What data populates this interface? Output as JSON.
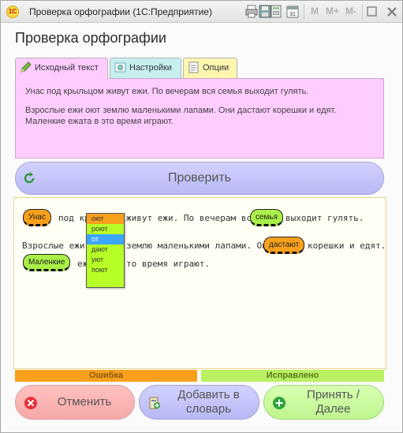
{
  "window": {
    "logo": "1С",
    "title": "Проверка орфографии  (1С:Предприятие)",
    "toolbar": {
      "m": "M",
      "m_plus": "M+",
      "m_minus": "M-"
    }
  },
  "page_title": "Проверка орфографии",
  "tabs": [
    {
      "label": "Исходный текст",
      "icon": "pencil-icon",
      "color": "#ffccff"
    },
    {
      "label": "Настройки",
      "icon": "settings-icon",
      "color": "#c6f0f0"
    },
    {
      "label": "Опции",
      "icon": "options-icon",
      "color": "#fff6b0"
    }
  ],
  "source_text": {
    "p1": "Унас под крыльцом живут ежи. По вечерам вся семья выходит гулять.",
    "p2": "Взрослые ежи оют землю маленькими лапами. Они дастают корешки и едят.",
    "p3": "Маленкие ежата в это время играют."
  },
  "check_button": "Проверить",
  "result": {
    "line1_a": "под кр",
    "line1_b": "живут ежи. По вечерам вся",
    "line1_c": "выходит гулять.",
    "line2_a": "Взрослые ежи",
    "line2_b": "землю маленькими лапами. Они",
    "line2_c": "корешки и едят.",
    "line3_a": "еж",
    "line3_b": "то время играют.",
    "chips": {
      "unas": "Унас",
      "semya": "семья",
      "dastayut": "дастают",
      "malenkie": "Маленкие"
    }
  },
  "suggestions": [
    "оют",
    "роют",
    "от",
    "дают",
    "уют",
    "поют"
  ],
  "legend": {
    "error": "Ошибка",
    "fixed": "Исправлено"
  },
  "buttons": {
    "cancel": "Отменить",
    "add_dict": "Добавить в словарь",
    "accept": "Принять / Далее"
  },
  "colors": {
    "error": "#f8a01c",
    "fixed": "#a8f048",
    "selected": "#3aa6ff"
  }
}
